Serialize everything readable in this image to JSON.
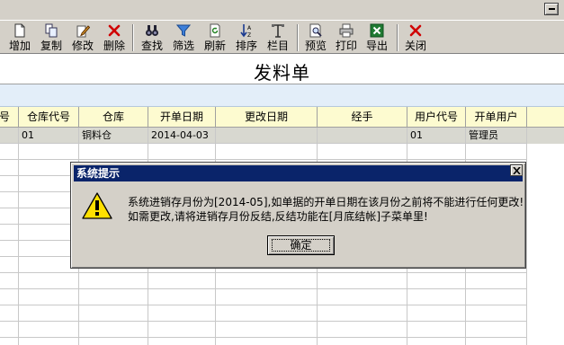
{
  "toolbar": {
    "items": [
      {
        "label": "增加",
        "icon": "new-doc-icon"
      },
      {
        "label": "复制",
        "icon": "copy-icon"
      },
      {
        "label": "修改",
        "icon": "edit-icon"
      },
      {
        "label": "删除",
        "icon": "delete-x-icon"
      },
      {
        "label": "查找",
        "icon": "binoculars-icon"
      },
      {
        "label": "筛选",
        "icon": "filter-icon"
      },
      {
        "label": "刷新",
        "icon": "refresh-icon"
      },
      {
        "label": "排序",
        "icon": "sort-icon"
      },
      {
        "label": "栏目",
        "icon": "columns-icon"
      },
      {
        "label": "预览",
        "icon": "preview-icon"
      },
      {
        "label": "打印",
        "icon": "print-icon"
      },
      {
        "label": "导出",
        "icon": "excel-export-icon"
      },
      {
        "label": "关闭",
        "icon": "close-x-icon"
      }
    ]
  },
  "page": {
    "title": "发料单"
  },
  "grid": {
    "columns": [
      "号",
      "仓库代号",
      "仓库",
      "开单日期",
      "更改日期",
      "经手",
      "用户代号",
      "开单用户"
    ],
    "rows": [
      {
        "cells": [
          "",
          "01",
          "铜料仓",
          "2014-04-03",
          "",
          "",
          "01",
          "管理员"
        ]
      }
    ]
  },
  "dialog": {
    "title": "系统提示",
    "message_line1": "系统进销存月份为[2014-05],如单据的开单日期在该月份之前将不能进行任何更改!",
    "message_line2": "如需更改,请将进销存月份反结,反结功能在[月底结帐]子菜单里!",
    "ok_label": "确定"
  },
  "colors": {
    "dialog_title_bg": "#0a246a",
    "grid_header_bg": "#fdfbd0",
    "toolbar_bg": "#d4d0c8"
  }
}
